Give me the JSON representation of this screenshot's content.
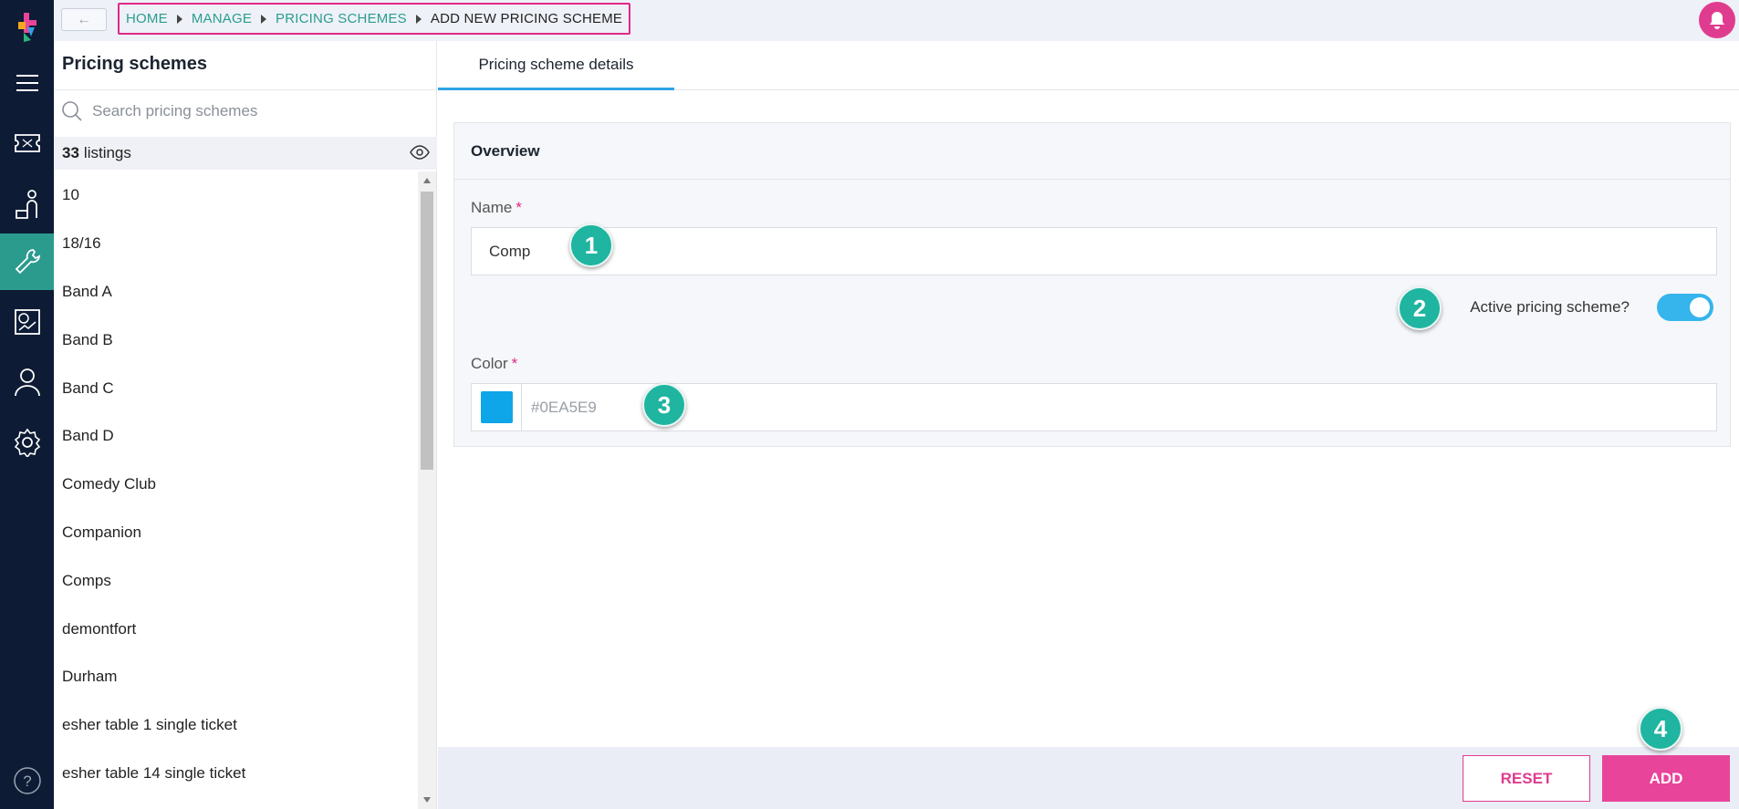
{
  "breadcrumb": [
    {
      "label": "HOME"
    },
    {
      "label": "MANAGE"
    },
    {
      "label": "PRICING SCHEMES"
    },
    {
      "label": "ADD NEW PRICING SCHEME"
    }
  ],
  "sidebar_nav": [
    "menu-icon",
    "ticket-icon",
    "customers-icon",
    "wrench-icon",
    "reports-icon",
    "user-icon",
    "gear-icon",
    "help-icon"
  ],
  "panel": {
    "title": "Pricing schemes",
    "search_placeholder": "Search pricing schemes",
    "listings_count": "33",
    "listings_label": "listings",
    "items": [
      "10",
      "18/16",
      "Band A",
      "Band B",
      "Band C",
      "Band D",
      "Comedy Club",
      "Companion",
      "Comps",
      "demontfort",
      "Durham",
      "esher table 1 single ticket",
      "esher table 14 single ticket"
    ]
  },
  "main": {
    "tab": "Pricing scheme details",
    "section_title": "Overview",
    "name_label": "Name",
    "name_value": "Comp",
    "active_label": "Active pricing scheme?",
    "active": true,
    "color_label": "Color",
    "color_placeholder": "#0EA5E9",
    "color_value": "#0EA5E9",
    "required_mark": "*"
  },
  "badges": [
    "1",
    "2",
    "3",
    "4"
  ],
  "actions": {
    "reset": "RESET",
    "add": "ADD"
  },
  "colors": {
    "accent": "#2a9d8f",
    "brand_pink": "#e8449a",
    "rail": "#0d1b35",
    "toggle": "#35b5ec"
  }
}
